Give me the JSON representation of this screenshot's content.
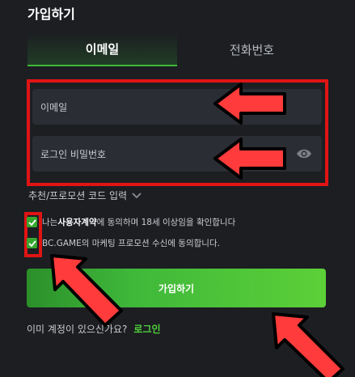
{
  "page": {
    "title": "가입하기"
  },
  "tabs": [
    {
      "label": "이메일",
      "active": true
    },
    {
      "label": "전화번호",
      "active": false
    }
  ],
  "form": {
    "email_placeholder": "이메일",
    "password_placeholder": "로그인 비밀번호",
    "password_toggle_icon": "eye-icon",
    "promo_label": "추천/프로모션 코드 입력",
    "promo_icon": "chevron-down-icon",
    "terms": {
      "prefix": "나는 ",
      "link": "사용자계약",
      "suffix": "에 동의하며 18세 이상임을 확인합니다",
      "checked": true
    },
    "marketing": {
      "label": "BC.GAME의 마케팅 프로모션 수신에 동의합니다.",
      "checked": true
    },
    "submit_label": "가입하기"
  },
  "footer": {
    "question": "이미 계정이 있으신가요?",
    "login_link": "로그인"
  },
  "colors": {
    "background": "#1c1e22",
    "accent": "#3fb83a",
    "annotation": "#e01414"
  }
}
